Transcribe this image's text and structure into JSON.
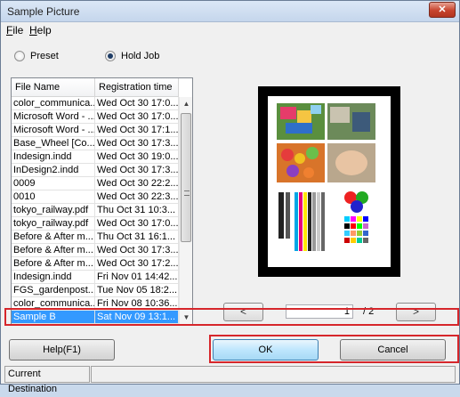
{
  "window": {
    "title": "Sample Picture",
    "close_glyph": "✕"
  },
  "menu": {
    "file": "File",
    "file_key": "F",
    "file_rest": "ile",
    "help": "Help",
    "help_key": "H",
    "help_rest": "elp"
  },
  "mode": {
    "preset_label": "Preset",
    "holdjob_label": "Hold Job",
    "selected": "Hold Job"
  },
  "filelist": {
    "col_name": "File Name",
    "col_time": "Registration time",
    "rows": [
      {
        "name": "color_communica...",
        "time": "Wed Oct 30 17:0..."
      },
      {
        "name": "Microsoft Word - ...",
        "time": "Wed Oct 30 17:0..."
      },
      {
        "name": "Microsoft Word - ...",
        "time": "Wed Oct 30 17:1..."
      },
      {
        "name": "Base_Wheel [Co...",
        "time": "Wed Oct 30 17:3..."
      },
      {
        "name": "Indesign.indd",
        "time": "Wed Oct 30 19:0..."
      },
      {
        "name": "InDesign2.indd",
        "time": "Wed Oct 30 17:3..."
      },
      {
        "name": "0009",
        "time": "Wed Oct 30 22:2..."
      },
      {
        "name": "0010",
        "time": "Wed Oct 30 22:3..."
      },
      {
        "name": "tokyo_railway.pdf",
        "time": "Thu Oct 31 10:3..."
      },
      {
        "name": "tokyo_railway.pdf",
        "time": "Wed Oct 30 17:0..."
      },
      {
        "name": "Before & After m...",
        "time": "Thu Oct 31 16:1..."
      },
      {
        "name": "Before & After m...",
        "time": "Wed Oct 30 17:3..."
      },
      {
        "name": "Before & After m...",
        "time": "Wed Oct 30 17:2..."
      },
      {
        "name": "Indesign.indd",
        "time": "Fri Nov 01 14:42..."
      },
      {
        "name": "FGS_gardenpost...",
        "time": "Tue Nov 05 18:2..."
      },
      {
        "name": "color_communica...",
        "time": "Fri Nov 08 10:36..."
      },
      {
        "name": "Sample B",
        "time": "Sat Nov 09 13:1..."
      }
    ],
    "selected_index": 16
  },
  "preview": {
    "page_current": "1",
    "page_total": "/ 2",
    "prev_label": "<",
    "next_label": ">"
  },
  "buttons": {
    "help": "Help(F1)",
    "ok": "OK",
    "cancel": "Cancel"
  },
  "status": {
    "current_destination": "Current Destination"
  },
  "colors": {
    "selection": "#3399ff",
    "highlight": "#d6262b"
  }
}
